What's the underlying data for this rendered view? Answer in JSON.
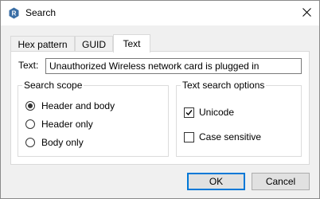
{
  "window": {
    "title": "Search",
    "icon": "app-icon",
    "close_icon": "close-icon"
  },
  "tabs": [
    {
      "label": "Hex pattern",
      "active": false
    },
    {
      "label": "GUID",
      "active": false
    },
    {
      "label": "Text",
      "active": true
    }
  ],
  "text_field": {
    "label": "Text:",
    "value": "Unauthorized Wireless network card is plugged in"
  },
  "search_scope": {
    "title": "Search scope",
    "options": [
      {
        "label": "Header and body",
        "checked": true
      },
      {
        "label": "Header only",
        "checked": false
      },
      {
        "label": "Body only",
        "checked": false
      }
    ]
  },
  "text_options": {
    "title": "Text search options",
    "options": [
      {
        "label": "Unicode",
        "checked": true
      },
      {
        "label": "Case sensitive",
        "checked": false
      }
    ]
  },
  "buttons": {
    "ok": "OK",
    "cancel": "Cancel"
  },
  "colors": {
    "accent": "#0078d7",
    "app_icon": "#3a6ea5"
  }
}
